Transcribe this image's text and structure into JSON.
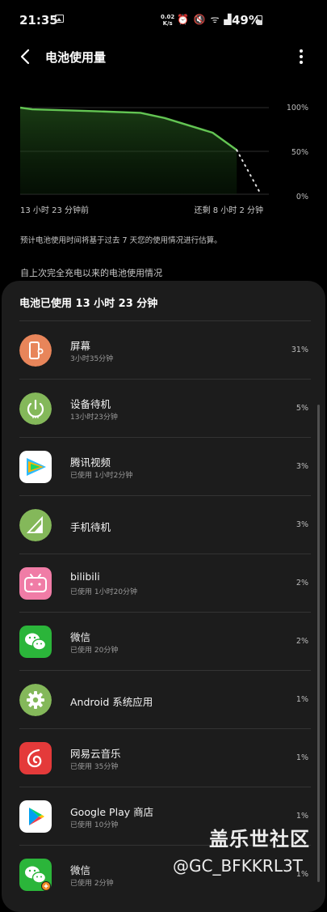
{
  "status_bar": {
    "time": "21:35",
    "net_speed_value": "0.02",
    "net_speed_unit": "K/s",
    "battery_percent": "49%"
  },
  "app_bar": {
    "title": "电池使用量",
    "back_icon": "chevron-left-icon",
    "more_icon": "more-vert-icon"
  },
  "chart": {
    "start_label": "13 小时 23 分钟前",
    "end_label": "还剩 8 小时 2 分钟",
    "note": "预计电池使用时间将基于过去 7 天您的使用情况进行估算。"
  },
  "chart_data": {
    "type": "line",
    "ytick_labels": [
      "100%",
      "50%",
      "0%"
    ],
    "ylim": [
      0,
      100
    ],
    "series": [
      {
        "values": [
          [
            0,
            100
          ],
          [
            0.05,
            98
          ],
          [
            0.3,
            96
          ],
          [
            0.5,
            94
          ],
          [
            0.6,
            88
          ],
          [
            0.8,
            71
          ],
          [
            0.9,
            51
          ]
        ]
      },
      {
        "style": "dotted",
        "values": [
          [
            0.9,
            51
          ],
          [
            1.0,
            0
          ]
        ]
      }
    ],
    "accent": "#63c453"
  },
  "section_label": "自上次完全充电以来的电池使用情况",
  "card": {
    "title": "电池已使用 13 小时 23 分钟",
    "apps": [
      {
        "name": "屏幕",
        "sub": "3小时35分钟",
        "pct": "31%",
        "icon": "phone-brightness-icon",
        "color": "#e8855a"
      },
      {
        "name": "设备待机",
        "sub": "13小时23分钟",
        "pct": "5%",
        "icon": "power-icon",
        "color": "#84b85a"
      },
      {
        "name": "腾讯视频",
        "sub": "已使用 1小时2分钟",
        "pct": "3%",
        "icon": "tencent-video-icon",
        "color": "#ffffff"
      },
      {
        "name": "手机待机",
        "sub": "",
        "pct": "3%",
        "icon": "signal-icon",
        "color": "#84b85a"
      },
      {
        "name": "bilibili",
        "sub": "已使用 1小时20分钟",
        "pct": "2%",
        "icon": "bilibili-icon",
        "color": "#f07ca6"
      },
      {
        "name": "微信",
        "sub": "已使用 20分钟",
        "pct": "2%",
        "icon": "wechat-icon",
        "color": "#2bb53a"
      },
      {
        "name": "Android 系统应用",
        "sub": "",
        "pct": "1%",
        "icon": "android-settings-icon",
        "color": "#84b85a"
      },
      {
        "name": "网易云音乐",
        "sub": "已使用 35分钟",
        "pct": "1%",
        "icon": "netease-music-icon",
        "color": "#e43a3a"
      },
      {
        "name": "Google Play 商店",
        "sub": "已使用 10分钟",
        "pct": "1%",
        "icon": "google-play-icon",
        "color": "#ffffff"
      },
      {
        "name": "微信",
        "sub": "已使用 2分钟",
        "pct": "1%",
        "icon": "wechat-clone-icon",
        "color": "#2bb53a"
      }
    ]
  },
  "watermark": {
    "line1": "盖乐世社区",
    "line2": "@GC_BFKKRL3T"
  }
}
